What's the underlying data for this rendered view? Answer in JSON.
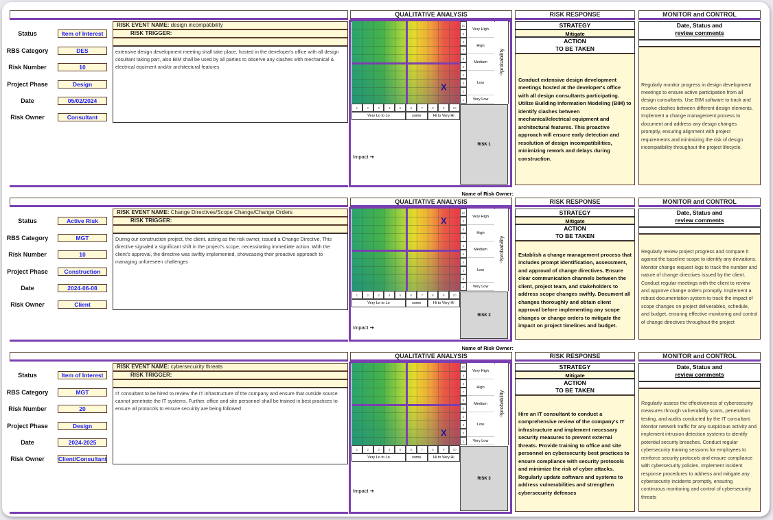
{
  "labels": {
    "status": "Status",
    "rbs": "RBS Category",
    "number": "Risk Number",
    "phase": "Project Phase",
    "date": "Date",
    "owner": "Risk Owner",
    "event_name": "RISK EVENT NAME:",
    "trigger": "RISK TRIGGER:",
    "qa_header": "QUALITATIVE ANALYSIS",
    "rr_header": "RISK RESPONSE",
    "mc_header": "MONITOR and CONTROL",
    "strategy": "STRATEGY",
    "action1": "ACTION",
    "action2": "TO BE TAKEN",
    "date_status1": "Date, Status and",
    "date_status2": "review comments",
    "probability": "probability",
    "impact": "Impact ➔",
    "probability_arrow": "🡡",
    "name_of_owner": "Name of Risk Owner:",
    "prob_levels": [
      "Very High",
      "High",
      "Medium",
      "Low",
      "Very Low"
    ],
    "impact_levels": [
      "Very Lo to Lo",
      "some",
      "Hi to Very Hi"
    ],
    "scale": [
      "1",
      "2",
      "3",
      "4",
      "5",
      "6",
      "7",
      "8",
      "9",
      "10"
    ],
    "mark": "X"
  },
  "colors": {
    "accent": "#7a3fb0",
    "value_text": "#1a1aff",
    "cell_fill": "#fff9d6",
    "mark": "#1a1a9a"
  },
  "risks": [
    {
      "status": "Item of Interest",
      "rbs": "DES",
      "number": "10",
      "phase": "Design",
      "date": "05/02/2024",
      "owner": "Consultant",
      "event": "design incompatibility",
      "description": "extensive design development meeting shall take place, hosted in the developer's office with all design cosultant taking part, also BIM shall be used by all parties to observe any clashes with mechanical & electrical equiment and/or architectural features",
      "risk_label": "RISK 1",
      "impact": 9,
      "probability": 2.5,
      "strategy": "Mitigate",
      "action": "Conduct extensive design development meetings hosted at the developer's office with all design consultants participating. Utilize Building Information Modeling (BIM) to identify clashes between mechanical/electrical equipment and architectural features. This proactive approach will ensure early detection and resolution of design incompatibilities, minimizing rework and delays during construction.",
      "monitor": "Regularly monitor progress in design development meetings to ensure active participation from all design consultants. Use BIM software to track and resolve clashes between different design elements. Implement a change management process to document and address any design changes promptly, ensuring alignment with project requirements and minimizing the risk of design incompatibility throughout the project lifecycle."
    },
    {
      "status": "Active Risk",
      "rbs": "MGT",
      "number": "10",
      "phase": "Construction",
      "date": "2024-06-08",
      "owner": "Client",
      "event": "Change Directives/Scope Change/Change Orders",
      "description": "During our construction project, the client, acting as the risk owner, issued a Change Directive. This directive signaled a significant shift in the project's scope, necessitating immediate action. With the client's approval, the directive was swiftly implemented, showcasing their proactive approach to managing unforeseen challenges",
      "risk_label": "RISK 2",
      "impact": 9,
      "probability": 9,
      "strategy": "Mitigate",
      "action": "Establish a change management process that includes prompt identification, assessment, and approval of change directives. Ensure clear communication channels between the client, project team, and stakeholders to address scope changes swiftly. Document all changes thoroughly and obtain client approval before implementing any scope changes or change orders to mitigate the impact on project timelines and budget.",
      "monitor": "Regularly review project progress and compare it against the baseline scope to identify any deviations. Monitor change request logs to track the number and nature of change directives issued by the client. Conduct regular meetings with the client to review and approve change orders promptly. Implement a robust documentation system to track the impact of scope changes on project deliverables, schedule, and budget, ensuring effective monitoring and control of change directives throughout the project"
    },
    {
      "status": "Item of Interest",
      "rbs": "MGT",
      "number": "20",
      "phase": "Design",
      "date": "2024-2025",
      "owner": "Client/Consultant",
      "event": "cybersecuirity threats",
      "description": "IT consultant to be hired to review the IT infrastructure of the company and ensure that outside source cannot penetrate the IT systems. Further, office and site personnel shall be trained in best practices to ensure all protocols to ensure secuirity are being followed",
      "risk_label": "RISK 3",
      "impact": 9,
      "probability": 2,
      "strategy": "Mitigate",
      "action": "Hire an IT consultant to conduct a comprehensive review of the company's IT infrastructure and implement necessary security measures to prevent external threats. Provide training to office and site personnel on cybersecurity best practices to ensure compliance with security protocols and minimize the risk of cyber attacks. Regularly update software and systems to address vulnerabilities and strengthen cybersecurity defenses",
      "monitor": "Regularly assess the effectiveness of cybersecurity measures through vulnerability scans, penetration testing, and audits conducted by the IT consultant. Monitor network traffic for any suspicious activity and implement intrusion detection systems to identify potential security breaches. Conduct regular cybersecurity training sessions for employees to reinforce security protocols and ensure compliance with cybersecurity policies. Implement incident response procedures to address and mitigate any cybersecurity incidents promptly, ensuring continuous monitoring and control of cybersecurity threats"
    }
  ]
}
